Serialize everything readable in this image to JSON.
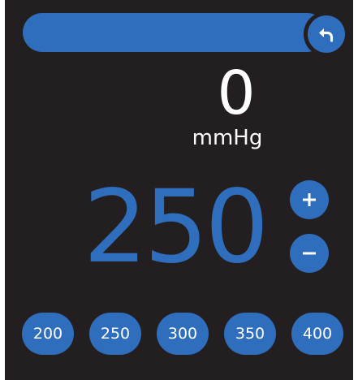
{
  "colors": {
    "accent": "#2f6ebc",
    "panel_background": "#231f20",
    "text": "#ffffff"
  },
  "header": {
    "back_icon": "undo-arrow-icon"
  },
  "readout": {
    "pressure_value": "0",
    "unit": "mmHg"
  },
  "target": {
    "value": "250",
    "increment_icon": "plus-icon",
    "decrement_icon": "minus-icon"
  },
  "presets": [
    "200",
    "250",
    "300",
    "350",
    "400"
  ]
}
